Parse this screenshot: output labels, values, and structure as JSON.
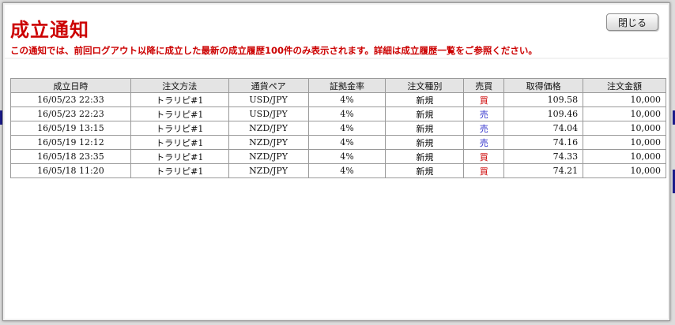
{
  "notice": {
    "title": "成立通知",
    "message": "この通知では、前回ログアウト以降に成立した最新の成立履歴100件のみ表示されます。詳細は成立履歴一覧をご参照ください。",
    "close_label": "閉じる"
  },
  "table": {
    "headers": [
      "成立日時",
      "注文方法",
      "通貨ペア",
      "証拠金率",
      "注文種別",
      "売買",
      "取得価格",
      "注文金額"
    ],
    "rows": [
      {
        "datetime": "16/05/23 22:33",
        "method": "トラリピ#1",
        "pair": "USD/JPY",
        "margin_rate": "4%",
        "order_type": "新規",
        "side": "買",
        "side_kind": "buy",
        "price": "109.58",
        "amount": "10,000"
      },
      {
        "datetime": "16/05/23 22:23",
        "method": "トラリピ#1",
        "pair": "USD/JPY",
        "margin_rate": "4%",
        "order_type": "新規",
        "side": "売",
        "side_kind": "sell",
        "price": "109.46",
        "amount": "10,000"
      },
      {
        "datetime": "16/05/19 13:15",
        "method": "トラリピ#1",
        "pair": "NZD/JPY",
        "margin_rate": "4%",
        "order_type": "新規",
        "side": "売",
        "side_kind": "sell",
        "price": "74.04",
        "amount": "10,000"
      },
      {
        "datetime": "16/05/19 12:12",
        "method": "トラリピ#1",
        "pair": "NZD/JPY",
        "margin_rate": "4%",
        "order_type": "新規",
        "side": "売",
        "side_kind": "sell",
        "price": "74.16",
        "amount": "10,000"
      },
      {
        "datetime": "16/05/18 23:35",
        "method": "トラリピ#1",
        "pair": "NZD/JPY",
        "margin_rate": "4%",
        "order_type": "新規",
        "side": "買",
        "side_kind": "buy",
        "price": "74.33",
        "amount": "10,000"
      },
      {
        "datetime": "16/05/18 11:20",
        "method": "トラリピ#1",
        "pair": "NZD/JPY",
        "margin_rate": "4%",
        "order_type": "新規",
        "side": "買",
        "side_kind": "buy",
        "price": "74.21",
        "amount": "10,000"
      }
    ]
  },
  "colors": {
    "title_red": "#cc0000",
    "buy": "#cc0000",
    "sell": "#3333cc"
  }
}
